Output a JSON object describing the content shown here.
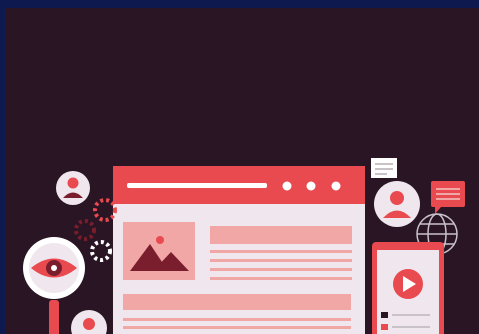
{
  "illustration": {
    "colors": {
      "outer_border": "#0e1a4f",
      "background": "#2a1525",
      "accent_red": "#e84a4f",
      "soft_pink": "#f0a7a6",
      "panel_light": "#efe6ee",
      "dark_maroon": "#7a1d2c",
      "white": "#ffffff",
      "grey": "#c9c2c9"
    },
    "icons": [
      "browser-window-icon",
      "image-placeholder-icon",
      "eye-icon",
      "magnifying-glass-icon",
      "gear-icon",
      "user-avatar-icon",
      "chat-bubble-icon",
      "globe-icon",
      "mobile-phone-icon",
      "play-button-icon",
      "document-icon"
    ]
  }
}
